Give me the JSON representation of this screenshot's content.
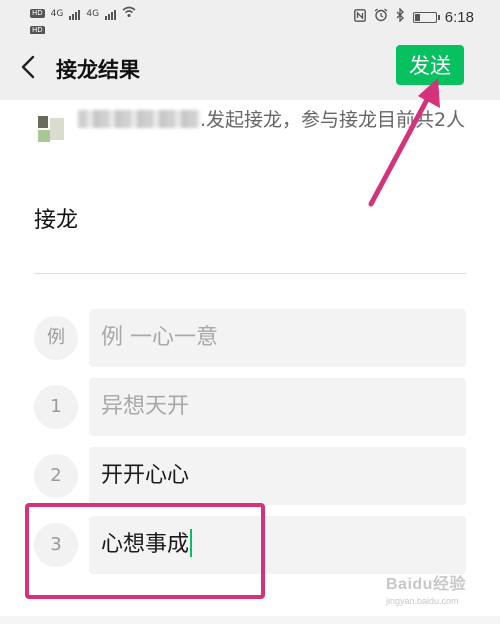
{
  "status_bar": {
    "network_labels": [
      "HD",
      "4G",
      "4G",
      "HD"
    ],
    "time": "6:18",
    "battery_level": 0.25
  },
  "header": {
    "title": "接龙结果",
    "send_label": "发送",
    "accent_color": "#07c160"
  },
  "intro": {
    "text_suffix": ".发起接龙，参与接龙目前共2人"
  },
  "topic": "接龙",
  "entries": [
    {
      "index": "例",
      "text": "例 一心一意",
      "placeholder": true
    },
    {
      "index": "1",
      "text": "异想天开",
      "placeholder": true
    },
    {
      "index": "2",
      "text": "开开心心",
      "placeholder": false
    },
    {
      "index": "3",
      "text": "心想事成",
      "placeholder": false
    }
  ],
  "annotation_color": "#d4327a",
  "watermark": {
    "logo": "Baidu经验",
    "url": "jingyan.baidu.com"
  }
}
